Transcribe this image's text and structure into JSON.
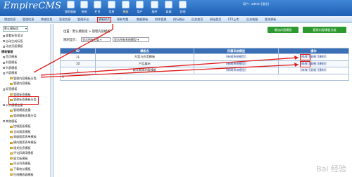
{
  "header": {
    "logo": "EmpireCMS",
    "user_label": "用户：",
    "user_name": "admin",
    "logout": "[退出]",
    "nav": [
      "我的面板",
      "系统",
      "栏目",
      "信息",
      "模板",
      "用户",
      "插件",
      "商城",
      "其他"
    ]
  },
  "subnav": [
    "增加信息",
    "管理信息",
    "审核信息",
    "签发信息",
    "管理评论",
    "更新碎片",
    "更新专题",
    "数据更新",
    "附件管理",
    "排行统计",
    "后台首页",
    "网站首页",
    "FTP上传",
    "后台地图",
    "版本更新"
  ],
  "sidebar": {
    "select": "默认模板组",
    "items": [
      {
        "type": "b",
        "label": "查看标签语法"
      },
      {
        "type": "b",
        "label": "自动生成标签"
      },
      {
        "type": "b",
        "label": "动态页面模板"
      },
      {
        "type": "h",
        "label": "模板管理"
      },
      {
        "type": "b",
        "label": "首页模板"
      },
      {
        "type": "b",
        "label": "封面模板"
      },
      {
        "type": "b",
        "label": "列表模板"
      },
      {
        "type": "b",
        "label": "内容模板"
      },
      {
        "type": "f",
        "label": "管理内容模板分类"
      },
      {
        "type": "f",
        "label": "管理内容模板"
      },
      {
        "type": "b",
        "label": "标签模板"
      },
      {
        "type": "f",
        "label": "管理标签模板"
      },
      {
        "type": "f",
        "label": "管理标签模板分类"
      },
      {
        "type": "b",
        "label": "公共模板变量"
      },
      {
        "type": "f",
        "label": "管理模板变量"
      },
      {
        "type": "f",
        "label": "管理模板变量分类"
      },
      {
        "type": "b",
        "label": "其他模板"
      },
      {
        "type": "f",
        "label": "控制面板模板"
      },
      {
        "type": "f",
        "label": "全站搜索模板"
      },
      {
        "type": "f",
        "label": "高级搜索表单模板"
      },
      {
        "type": "f",
        "label": "横向搜索表单模板"
      },
      {
        "type": "f",
        "label": "相关信息模板"
      },
      {
        "type": "f",
        "label": "评论JS调用模板"
      },
      {
        "type": "f",
        "label": "留言板模板"
      },
      {
        "type": "f",
        "label": "评论列表模板"
      },
      {
        "type": "f",
        "label": "下载地址模板"
      },
      {
        "type": "f",
        "label": "在线播放器模板"
      }
    ]
  },
  "content": {
    "crumb": "位置：默认模板组 > 管理内容模板",
    "btn_add": "增加内容模板",
    "btn_manage": "管理内容模板分类",
    "filter_label": "限制显示：",
    "filter_class": "显示所有分类",
    "filter_model": "显示所有系统模型",
    "table": {
      "headers": [
        "ID",
        "模板名",
        "所属系统模型",
        "操作"
      ],
      "rows": [
        {
          "id": "11",
          "name": "方案与应用模板",
          "model": "[新闻系统模型]",
          "ops": [
            "[修改]",
            "[复制]",
            "[删除]"
          ]
        },
        {
          "id": "10",
          "name": "产品展示",
          "model": "[新闻系统模型]",
          "ops": [
            "[修改]",
            "[复制]",
            "[删除]"
          ]
        },
        {
          "id": "1",
          "name": "默认新闻内容模板",
          "model": "[新闻系统模型]",
          "ops": [
            "[修改]",
            "[复制]",
            "[删除]"
          ]
        }
      ],
      "footer": "3"
    }
  },
  "watermark": "Bai 经验"
}
